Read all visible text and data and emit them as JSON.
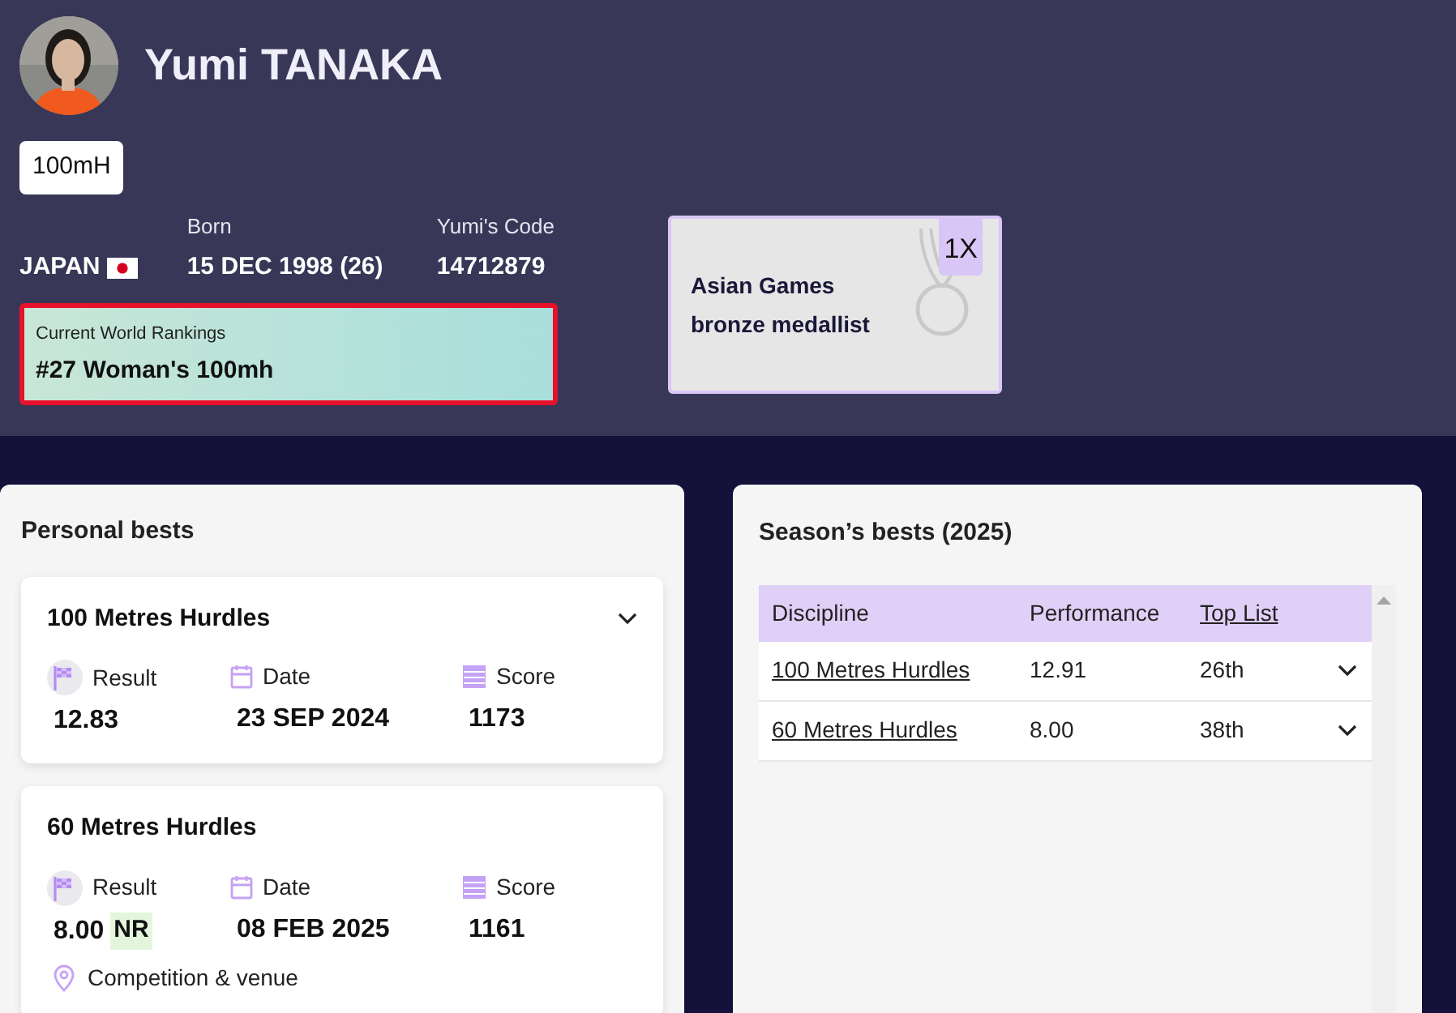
{
  "athlete": {
    "name": "Yumi TANAKA",
    "discipline_tag": "100mH",
    "country": "JAPAN",
    "born_label": "Born",
    "born": "15 DEC 1998 (26)",
    "code_label": "Yumi's Code",
    "code": "14712879"
  },
  "ranking": {
    "label": "Current World Rankings",
    "value": "#27 Woman's 100mh"
  },
  "honour": {
    "title": "Asian Games bronze medallist",
    "count": "1X"
  },
  "personal_bests": {
    "title": "Personal bests",
    "cards": [
      {
        "discipline": "100 Metres Hurdles",
        "expanded": false,
        "result_label": "Result",
        "result": "12.83",
        "date_label": "Date",
        "date": "23 SEP 2024",
        "score_label": "Score",
        "score": "1173"
      },
      {
        "discipline": "60 Metres Hurdles",
        "expanded": true,
        "result_label": "Result",
        "result": "8.00",
        "record": "NR",
        "date_label": "Date",
        "date": "08 FEB 2025",
        "score_label": "Score",
        "score": "1161",
        "venue_label": "Competition & venue"
      }
    ]
  },
  "season_bests": {
    "title": "Season’s bests (2025)",
    "columns": [
      "Discipline",
      "Performance",
      "Top List"
    ],
    "rows": [
      {
        "discipline": "100 Metres Hurdles",
        "performance": "12.91",
        "top_list": "26th"
      },
      {
        "discipline": "60 Metres Hurdles",
        "performance": "8.00",
        "top_list": "38th"
      }
    ]
  }
}
